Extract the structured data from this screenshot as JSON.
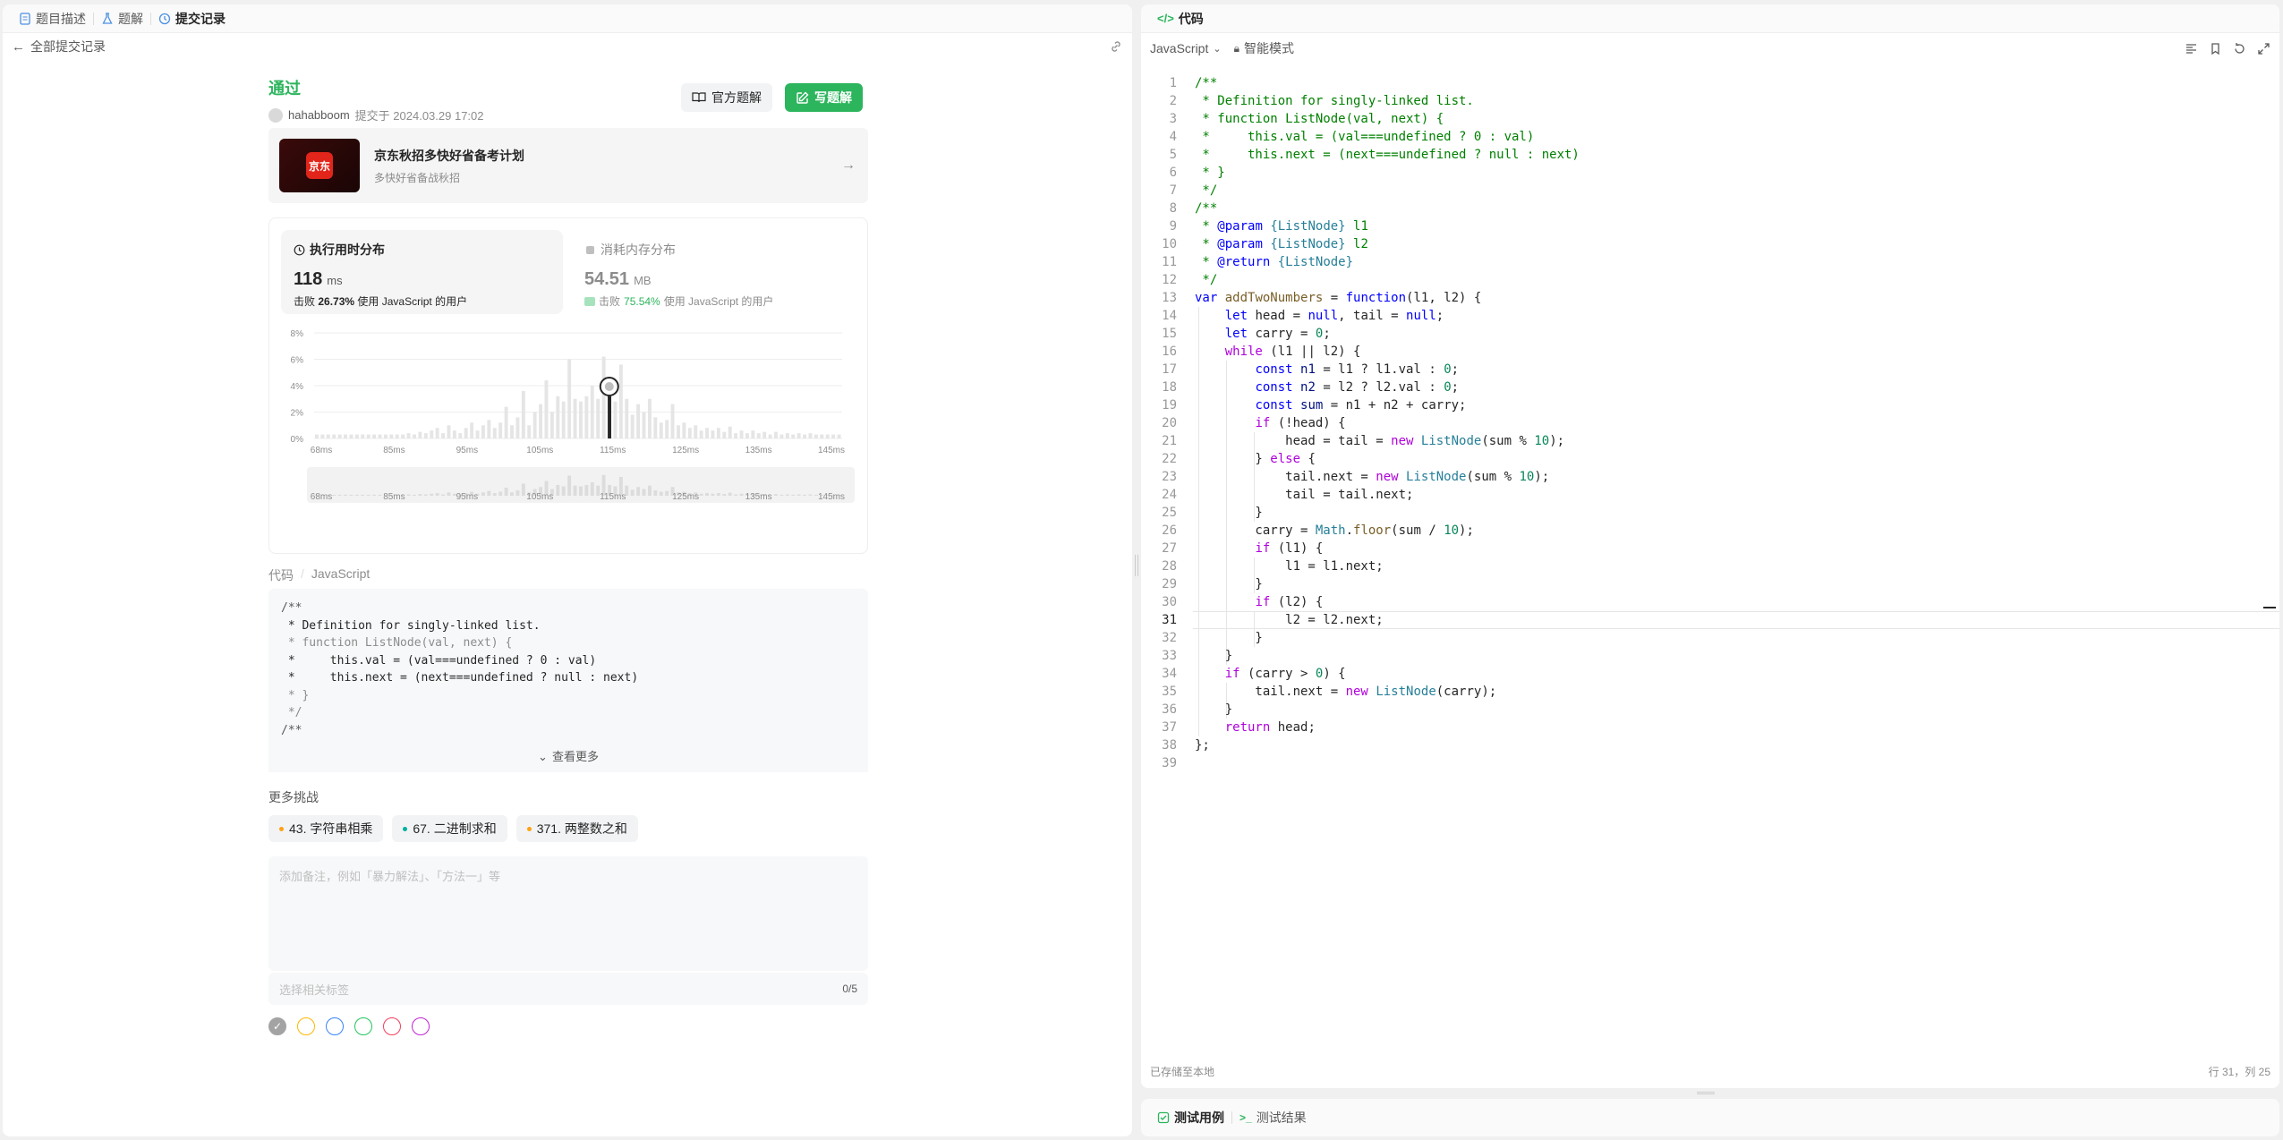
{
  "left_tabs": [
    {
      "label": "题目描述",
      "icon": "document-icon"
    },
    {
      "label": "题解",
      "icon": "flask-icon"
    },
    {
      "label": "提交记录",
      "icon": "history-icon"
    }
  ],
  "back_label": "全部提交记录",
  "submission": {
    "status": "通过",
    "author": "hahabboom",
    "submitted_at": "提交于 2024.03.29 17:02",
    "official_btn": "官方题解",
    "write_btn": "写题解"
  },
  "ad": {
    "logo_text": "京东",
    "title": "京东秋招多快好省备考计划",
    "subtitle": "多快好省备战秋招"
  },
  "runtime": {
    "label": "执行用时分布",
    "value": "118",
    "unit": "ms",
    "beats_prefix": "击败",
    "beats": "26.73%",
    "beats_suffix": "使用 JavaScript 的用户"
  },
  "memory": {
    "label": "消耗内存分布",
    "value": "54.51",
    "unit": "MB",
    "beats_prefix": "击败",
    "beats": "75.54%",
    "beats_suffix": "使用 JavaScript 的用户"
  },
  "chart_data": {
    "type": "bar",
    "y_ticks": [
      "8%",
      "6%",
      "4%",
      "2%",
      "0%"
    ],
    "x_ticks": [
      "68ms",
      "85ms",
      "95ms",
      "105ms",
      "115ms",
      "125ms",
      "135ms",
      "145ms"
    ],
    "ylim": [
      0,
      8
    ],
    "values": [
      0.3,
      0.3,
      0.3,
      0.3,
      0.3,
      0.3,
      0.3,
      0.3,
      0.3,
      0.3,
      0.3,
      0.3,
      0.3,
      0.3,
      0.3,
      0.3,
      0.4,
      0.3,
      0.5,
      0.4,
      0.6,
      0.8,
      0.4,
      1.0,
      0.6,
      0.4,
      0.8,
      1.2,
      0.6,
      1.0,
      1.4,
      0.8,
      1.2,
      2.4,
      1.0,
      1.6,
      3.6,
      1.0,
      2.0,
      2.6,
      4.4,
      2.0,
      3.2,
      2.8,
      6.0,
      3.0,
      2.8,
      3.2,
      4.0,
      3.0,
      6.2,
      3.2,
      2.8,
      5.6,
      3.0,
      1.8,
      2.6,
      2.0,
      3.0,
      1.6,
      1.2,
      1.4,
      2.6,
      1.0,
      1.2,
      0.8,
      1.0,
      0.6,
      0.8,
      0.6,
      0.8,
      0.5,
      0.9,
      0.4,
      0.6,
      0.4,
      0.6,
      0.4,
      0.5,
      0.3,
      0.5,
      0.3,
      0.4,
      0.3,
      0.4,
      0.3,
      0.4,
      0.3,
      0.3,
      0.3,
      0.3,
      0.3
    ],
    "highlight_index": 51
  },
  "code_section": {
    "title": "代码",
    "lang": "JavaScript",
    "preview": [
      "/**",
      " * Definition for singly-linked list.",
      " * function ListNode(val, next) {",
      " *     this.val = (val===undefined ? 0 : val)",
      " *     this.next = (next===undefined ? null : next)",
      " * }",
      " */",
      "/**"
    ],
    "more": "查看更多"
  },
  "more_challenges": {
    "title": "更多挑战",
    "items": [
      {
        "label": "43. 字符串相乘",
        "color": "#ffa116"
      },
      {
        "label": "67. 二进制求和",
        "color": "#00af9b"
      },
      {
        "label": "371. 两整数之和",
        "color": "#ffa116"
      }
    ]
  },
  "notes": {
    "placeholder": "添加备注，例如「暴力解法」、「方法一」等",
    "tags_placeholder": "选择相关标签",
    "count": "0/5"
  },
  "tag_colors": [
    "#a3a3a3",
    "#ffb800",
    "#3b82f6",
    "#22c55e",
    "#f43f5e",
    "#c026d3"
  ],
  "right": {
    "title": "代码",
    "lang": "JavaScript",
    "mode": "智能模式",
    "saved": "已存储至本地",
    "cursor": "行 31，列 25"
  },
  "bottom_tabs": [
    {
      "label": "测试用例"
    },
    {
      "label": "测试结果"
    }
  ],
  "code_lines": [
    "/**",
    " * Definition for singly-linked list.",
    " * function ListNode(val, next) {",
    " *     this.val = (val===undefined ? 0 : val)",
    " *     this.next = (next===undefined ? null : next)",
    " * }",
    " */",
    "/**",
    " * @param {ListNode} l1",
    " * @param {ListNode} l2",
    " * @return {ListNode}",
    " */",
    "var addTwoNumbers = function(l1, l2) {",
    "    let head = null, tail = null;",
    "    let carry = 0;",
    "    while (l1 || l2) {",
    "        const n1 = l1 ? l1.val : 0;",
    "        const n2 = l2 ? l2.val : 0;",
    "        const sum = n1 + n2 + carry;",
    "        if (!head) {",
    "            head = tail = new ListNode(sum % 10);",
    "        } else {",
    "            tail.next = new ListNode(sum % 10);",
    "            tail = tail.next;",
    "        }",
    "        carry = Math.floor(sum / 10);",
    "        if (l1) {",
    "            l1 = l1.next;",
    "        }",
    "        if (l2) {",
    "            l2 = l2.next;",
    "        }",
    "    }",
    "    if (carry > 0) {",
    "        tail.next = new ListNode(carry);",
    "    }",
    "    return head;",
    "};",
    ""
  ],
  "line_numbers": [
    "1",
    "2",
    "3",
    "4",
    "5",
    "6",
    "7",
    "8",
    "9",
    "10",
    "11",
    "12",
    "13",
    "14",
    "15",
    "16",
    "17",
    "18",
    "19",
    "20",
    "21",
    "22",
    "23",
    "24",
    "25",
    "26",
    "27",
    "28",
    "29",
    "30",
    "31",
    "32",
    "33",
    "34",
    "35",
    "36",
    "37",
    "38",
    "39"
  ]
}
